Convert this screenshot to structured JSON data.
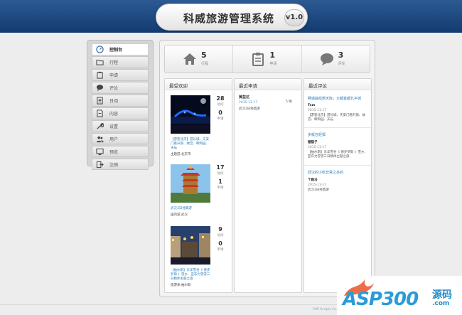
{
  "header": {
    "title": "科威旅游管理系统",
    "version": "v1.0"
  },
  "sidebar": {
    "items": [
      {
        "label": "控制台",
        "icon": "dashboard-icon",
        "active": true
      },
      {
        "label": "行程",
        "icon": "folder-icon"
      },
      {
        "label": "申请",
        "icon": "clipboard-icon"
      },
      {
        "label": "评论",
        "icon": "comment-icon"
      },
      {
        "label": "日阅",
        "icon": "document-icon"
      },
      {
        "label": "内容",
        "icon": "page-icon"
      },
      {
        "label": "设置",
        "icon": "wrench-icon"
      },
      {
        "label": "用户",
        "icon": "users-icon"
      },
      {
        "label": "预览",
        "icon": "monitor-icon"
      },
      {
        "label": "注销",
        "icon": "logout-icon"
      }
    ]
  },
  "stats": [
    {
      "value": "5",
      "label": "行程",
      "icon": "home-icon"
    },
    {
      "value": "1",
      "label": "申请",
      "icon": "clipboard-icon"
    },
    {
      "value": "3",
      "label": "评论",
      "icon": "comment-icon"
    }
  ],
  "popular": {
    "heading": "最受欢迎",
    "items": [
      {
        "title": "【游客北京】游长城、天安门看升旗、故宫、颐和园、天坛",
        "location": "主题游,北京市",
        "views": "28",
        "views_label": "访问",
        "requests": "0",
        "requests_label": "申请"
      },
      {
        "title": "武汉3日经典游",
        "location": "国内游,武汉",
        "views": "17",
        "views_label": "访问",
        "requests": "1",
        "requests_label": "申请"
      },
      {
        "title": "【袖尔斯】东华雪谷《 德步罗斯 》雪乡、亚布力雪雪三日精体主题之旅",
        "location": "旅游季,袖尔斯",
        "views": "9",
        "views_label": "访问",
        "requests": "0",
        "requests_label": "申请"
      }
    ]
  },
  "requests": {
    "heading": "最近申请",
    "items": [
      {
        "name": "黄益达",
        "days": "5 晚",
        "date": "2015-11-17",
        "message": "武汉3日经典游"
      }
    ]
  },
  "comments": {
    "heading": "最近评论",
    "items": [
      {
        "title": "畅城曲线燃天际，大都首都北平城",
        "user": "Tom",
        "date": "2015-11-17",
        "body": "【游客北京】游长城、天安门看升旗、故宫、颐和园、天坛"
      },
      {
        "title": "步艇在轻狐",
        "user": "傲猫子",
        "date": "2015-11-17",
        "body": "【袖尔斯】东华雪谷《 德步罗斯 》雪乡、亚布力雪雪三日精体主题之旅"
      },
      {
        "title": "武汉的小吃非常之多的",
        "user": "个路马",
        "date": "2015-11-17",
        "body": "武汉3日经典游"
      }
    ]
  },
  "footer": {
    "text": "PHP Scripts Co."
  },
  "watermark": {
    "text": "ASP300",
    "cn": "源码",
    "domain": ".com"
  }
}
